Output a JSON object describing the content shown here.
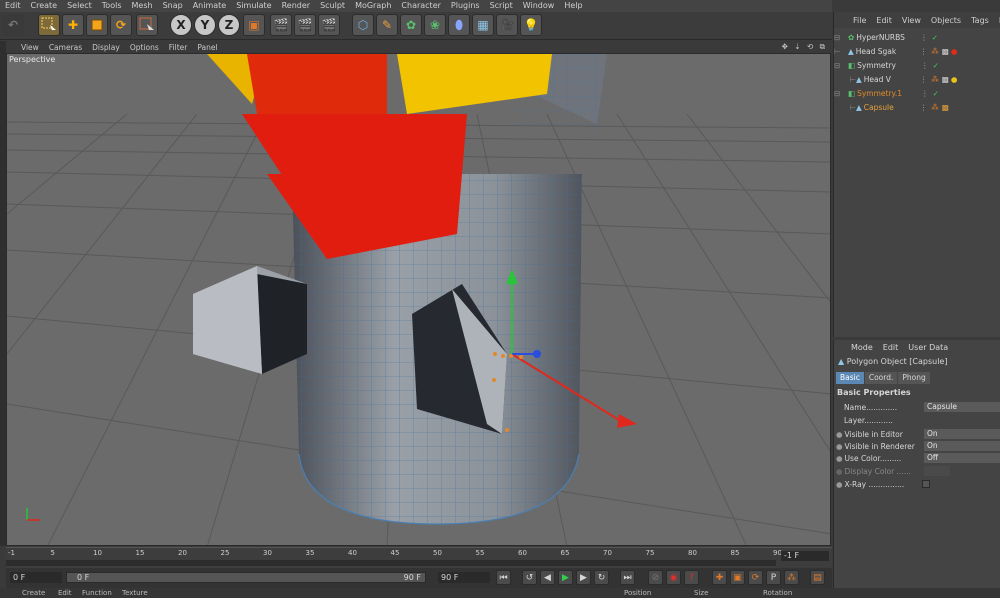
{
  "menu": [
    "Edit",
    "Create",
    "Select",
    "Tools",
    "Mesh",
    "Snap",
    "Animate",
    "Simulate",
    "Render",
    "Sculpt",
    "MoGraph",
    "Character",
    "Plugins",
    "Script",
    "Window",
    "Help"
  ],
  "toolbar": {
    "axis_x": "X",
    "axis_y": "Y",
    "axis_z": "Z"
  },
  "viewport": {
    "menu": [
      "View",
      "Cameras",
      "Display",
      "Options",
      "Filter",
      "Panel"
    ],
    "label": "Perspective"
  },
  "timeline": {
    "ticks": [
      "-1",
      "5",
      "10",
      "15",
      "20",
      "25",
      "30",
      "35",
      "40",
      "45",
      "50",
      "55",
      "60",
      "65",
      "70",
      "75",
      "80",
      "85",
      "90"
    ],
    "current_frame": "-1 F",
    "start_field": "0 F",
    "range_start": "0 F",
    "range_end": "90 F",
    "end_field": "90 F"
  },
  "object_manager": {
    "menu": [
      "File",
      "Edit",
      "View",
      "Objects",
      "Tags",
      "Bo"
    ],
    "objects": [
      {
        "name": "HyperNURBS",
        "highlight": false
      },
      {
        "name": "Head Sgak",
        "highlight": false
      },
      {
        "name": "Symmetry",
        "highlight": false
      },
      {
        "name": "Head V",
        "highlight": false
      },
      {
        "name": "Symmetry.1",
        "highlight": true
      },
      {
        "name": "Capsule",
        "highlight": true
      }
    ]
  },
  "attributes": {
    "menu": [
      "Mode",
      "Edit",
      "User Data"
    ],
    "object_title": "Polygon Object [Capsule]",
    "tabs": [
      "Basic",
      "Coord.",
      "Phong"
    ],
    "section": "Basic Properties",
    "rows": [
      {
        "label": "Name.............",
        "value": "Capsule"
      },
      {
        "label": "Layer............",
        "value": ""
      },
      {
        "label": "Visible in Editor",
        "value": "On"
      },
      {
        "label": "Visible in Renderer",
        "value": "On"
      },
      {
        "label": "Use Color.........",
        "value": "Off"
      },
      {
        "label": "Display Color ......",
        "value": ""
      },
      {
        "label": "X-Ray ...............",
        "value": ""
      }
    ]
  },
  "bottom": {
    "tabs": [
      "Create",
      "Edit",
      "Function",
      "Texture"
    ],
    "coord_headers": [
      "Position",
      "Size",
      "Rotation"
    ]
  },
  "colors": {
    "selection_orange": "#e08a2a",
    "active_blue": "#5b87b5",
    "viewport_bg": "#6b6b6b"
  }
}
